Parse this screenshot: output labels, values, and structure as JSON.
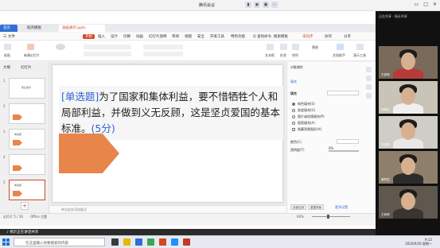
{
  "window": {
    "title": "腾讯会议",
    "signal": "all",
    "controls": [
      "▭",
      "□",
      "✕"
    ]
  },
  "tabs": {
    "home": "首页",
    "doc1": "稻壳模板",
    "doc2": "油画通识.pptx"
  },
  "menu": {
    "file": "三 文件",
    "items": [
      "开始",
      "插入",
      "设计",
      "切换",
      "动画",
      "幻灯片放映",
      "审阅",
      "视图",
      "安全",
      "开发工具",
      "特色功能"
    ],
    "search": "Q 查找命令, 搜索模板",
    "collab": "未同步",
    "share": "协作",
    "share2": "分享"
  },
  "ribbon": {
    "paste": "粘贴",
    "new_slide": "新建幻灯片",
    "textbox": "文本框",
    "shape": "形状",
    "arrange": "排列",
    "replace": "替换",
    "wordart": "文档助手",
    "tools": "演示工具"
  },
  "thumbs": {
    "header_outline": "大纲",
    "header_slides": "幻灯片",
    "items": [
      {
        "num": "1",
        "title": "职业素养"
      },
      {
        "num": "2",
        "title": ""
      },
      {
        "num": "3",
        "title": "单选题"
      },
      {
        "num": "4",
        "title": ""
      },
      {
        "num": "5",
        "title": "单选题"
      }
    ],
    "add": "+"
  },
  "slide": {
    "tag": "[单选题]",
    "question": "为了国家和集体利益，要不惜牺牲个人和局部利益，并做到义无反顾，这是坚贞爱国的基本标准。",
    "score": "(5分)"
  },
  "notes": {
    "placeholder": "单击此处添加备注"
  },
  "pane": {
    "title": "对象属性",
    "tab_fill": "填充",
    "section": "填充",
    "opt1": "纯色填充(S)",
    "opt2": "渐变填充(G)",
    "opt3": "图片或纹理填充(P)",
    "opt4": "图案填充(A)",
    "opt5": "隐藏背景图形(H)",
    "color_label": "颜色(C)",
    "trans_label": "透明度(T)",
    "trans_value": "0%",
    "btn_apply": "全部应用",
    "btn_reset": "重置背景",
    "btn_more": "更多设置"
  },
  "status": {
    "slide_pos": "幻灯片 5 / 16",
    "theme": "Office 主题",
    "zoom": "64%"
  },
  "meeting": {
    "banner": "♪ 杨沂正在讲话共享"
  },
  "taskbar": {
    "search": "在这里输入你要搜索的内容",
    "time": "9:12",
    "date": "2020/6/26 星期一"
  },
  "participants": {
    "header": "正在共享 · 杨沂共享",
    "people": [
      {
        "name": "王钟明"
      },
      {
        "name": "汤博文"
      },
      {
        "name": "刘佳慧"
      },
      {
        "name": "黄梦如"
      },
      {
        "name": "王钟明"
      }
    ]
  },
  "colors": {
    "accent": "#d24726",
    "arrow": "#e8854a",
    "tag_blue": "#2b5fd6"
  }
}
